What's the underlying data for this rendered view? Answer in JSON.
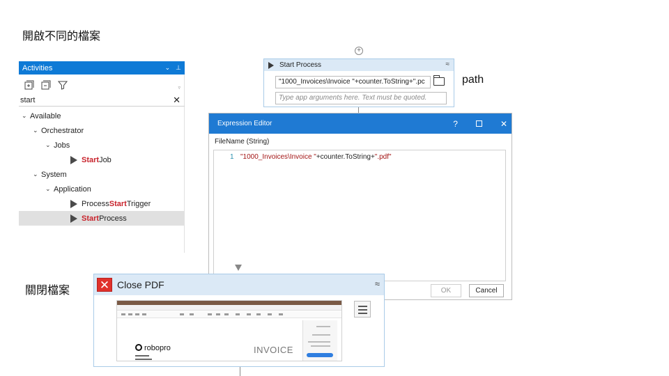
{
  "headings": {
    "open_file": "開啟不同的檔案",
    "close_file": "關閉檔案",
    "path_label": "path"
  },
  "activities_panel": {
    "title": "Activities",
    "title_icons": [
      "⌄",
      "⊥"
    ],
    "search_value": "start",
    "clear_symbol": "✕",
    "tree": {
      "available": "Available",
      "orchestrator": "Orchestrator",
      "jobs": "Jobs",
      "start_job": {
        "highlight": "Start",
        "rest": " Job"
      },
      "system": "System",
      "application": "Application",
      "process_start_trigger": {
        "pre": "Process ",
        "highlight": "Start",
        "rest": " Trigger"
      },
      "start_process": {
        "highlight": "Start",
        "rest": " Process"
      }
    }
  },
  "start_process_activity": {
    "add_symbol": "+",
    "title": "Start Process",
    "collapse_symbol": "≈",
    "filename_value": "\"1000_Invoices\\Invoice \"+counter.ToString+\".pc",
    "arguments_placeholder": "Type app arguments here. Text must be quoted."
  },
  "expression_editor": {
    "title": "Expression Editor",
    "help": "?",
    "close": "✕",
    "label": "FileName (String)",
    "line_number": "1",
    "code": {
      "part1": "\"1000_Invoices\\Invoice \"",
      "part2": "+counter.ToString+",
      "part3": "\".pdf\""
    },
    "ok_label": "OK",
    "cancel_label": "Cancel"
  },
  "close_pdf_activity": {
    "icon_symbol": "✕",
    "title": "Close PDF",
    "collapse_symbol": "≈",
    "screenshot": {
      "logo_text": "robopro",
      "invoice_text": "INVOICE"
    }
  },
  "colors": {
    "accent_blue": "#1f7ad3",
    "activity_header": "#dbe9f6",
    "highlight_red": "#c8232c",
    "close_icon_red": "#e0312b"
  },
  "icons": [
    "expand-all-icon",
    "collapse-all-icon",
    "filter-icon",
    "folder-icon",
    "play-icon",
    "close-icon",
    "menu-icon"
  ]
}
